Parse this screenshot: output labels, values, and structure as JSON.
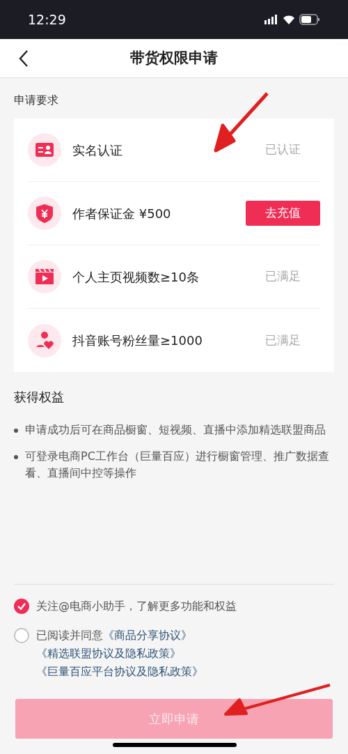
{
  "status_bar": {
    "time": "12:29"
  },
  "nav": {
    "title": "带货权限申请"
  },
  "requirements": {
    "heading": "申请要求",
    "items": [
      {
        "label": "实名认证",
        "kind": "status",
        "status": "已认证"
      },
      {
        "label": "作者保证金 ¥500",
        "kind": "button",
        "action": "去充值"
      },
      {
        "label": "个人主页视频数≥10条",
        "kind": "status",
        "status": "已满足"
      },
      {
        "label": "抖音账号粉丝量≥1000",
        "kind": "status",
        "status": "已满足"
      }
    ]
  },
  "benefits": {
    "heading": "获得权益",
    "items": [
      "申请成功后可在商品橱窗、短视频、直播中添加精选联盟商品",
      "可登录电商PC工作台（巨量百应）进行橱窗管理、推广数据查看、直播间中控等操作"
    ]
  },
  "options": [
    {
      "kind": "plain",
      "checked": true,
      "text": "关注@电商小助手，了解更多功能和权益"
    },
    {
      "kind": "agreement",
      "checked": false,
      "text": "已阅读并同意",
      "links": [
        "《商品分享协议》",
        "《精选联盟协议及隐私政策》",
        "《巨量百应平台协议及隐私政策》"
      ]
    }
  ],
  "apply_button": {
    "label": "立即申请",
    "disabled": true
  }
}
